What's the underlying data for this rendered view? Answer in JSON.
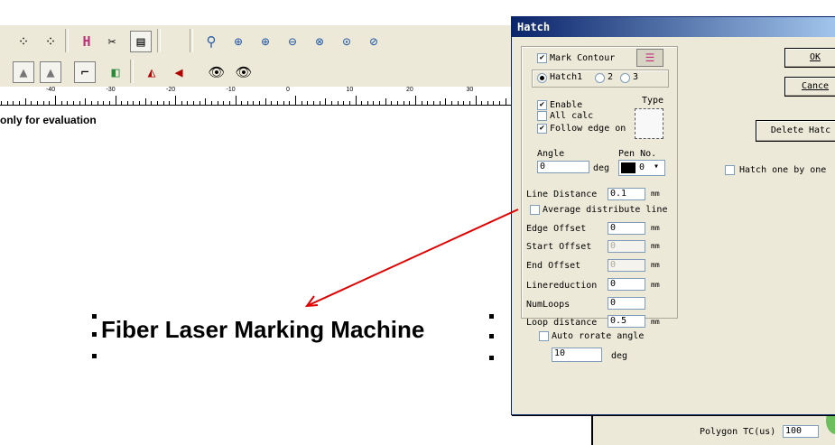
{
  "canvas": {
    "evaluation_text": "only for evaluation",
    "object_text": "Fiber Laser Marking Machine",
    "ruler_labels": [
      "-40",
      "-30",
      "-20",
      "-10",
      "0",
      "10",
      "20",
      "30"
    ]
  },
  "toolbar": {
    "row1_icons": [
      "node-icon",
      "node-icon",
      "hatch-icon",
      "tools-icon",
      "table-icon",
      "zoom-icon",
      "zoom-in-icon",
      "zoom-in-icon",
      "zoom-out-icon",
      "zoom-all-icon",
      "zoom-fit-icon",
      "zoom-page-icon"
    ],
    "row2_icons": [
      "lock-icon",
      "unlock-icon",
      "pivot-icon",
      "arrange-icon",
      "mirror-h-icon",
      "mirror-v-icon",
      "view-icon",
      "view-icon"
    ]
  },
  "dialog": {
    "title": "Hatch",
    "mark_contour": "Mark Contour",
    "hatch1": "Hatch1",
    "hatch2": "2",
    "hatch3": "3",
    "enable": "Enable",
    "type": "Type",
    "all_calc": "All calc",
    "follow_edge": "Follow edge on",
    "angle_label": "Angle",
    "angle_value": "0",
    "deg": "deg",
    "pen_label": "Pen No.",
    "pen_value": "0",
    "line_distance_label": "Line Distance",
    "line_distance_value": "0.1",
    "mm": "mm",
    "average_distribute": "Average distribute line",
    "edge_offset_label": "Edge Offset",
    "edge_offset_value": "0",
    "start_offset_label": "Start Offset",
    "start_offset_value": "0",
    "end_offset_label": "End Offset",
    "end_offset_value": "0",
    "linereduction_label": "Linereduction",
    "linereduction_value": "0",
    "numloops_label": "NumLoops",
    "numloops_value": "0",
    "loop_distance_label": "Loop distance",
    "loop_distance_value": "0.5",
    "auto_rotate": "Auto rorate angle",
    "auto_rotate_value": "10",
    "ok": "OK",
    "cancel": "Cance",
    "delete_hatch": "Delete Hatc",
    "hatch_one_by_one": "Hatch one by one"
  },
  "background_panel": {
    "polygon_label": "Polygon TC(us)",
    "polygon_value": "100"
  },
  "colors": {
    "annotation_arrow": "#e00000",
    "titlebar": "#0a246a"
  }
}
